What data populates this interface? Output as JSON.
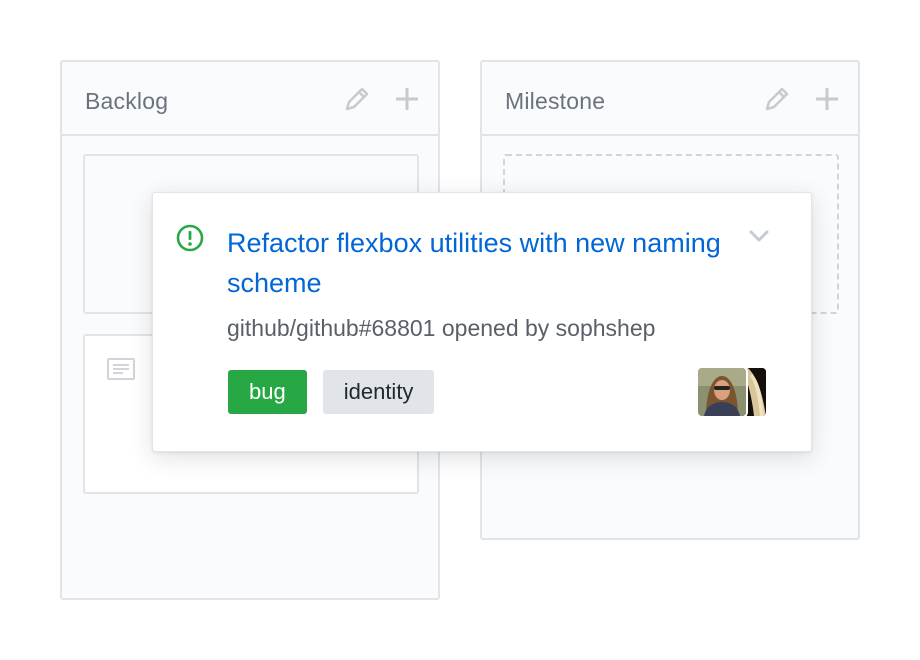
{
  "colors": {
    "link": "#0366d6",
    "open_issue_green": "#28a745",
    "label_bug_bg": "#28a745",
    "label_identity_bg": "#e1e4e8",
    "border": "#e1e4e8",
    "muted_text": "#6a737d"
  },
  "columns": [
    {
      "title": "Backlog",
      "icons": [
        "pencil-icon",
        "plus-icon"
      ]
    },
    {
      "title": "Milestone",
      "icons": [
        "pencil-icon",
        "plus-icon"
      ]
    }
  ],
  "issue": {
    "status_icon": "issue-opened-icon",
    "title": "Refactor flexbox utilities with new naming scheme",
    "meta": "github/github#68801 opened by sophshep",
    "labels": [
      {
        "name": "bug",
        "color": "#28a745"
      },
      {
        "name": "identity",
        "color": "#e1e4e8"
      }
    ],
    "avatar_count": 2
  }
}
